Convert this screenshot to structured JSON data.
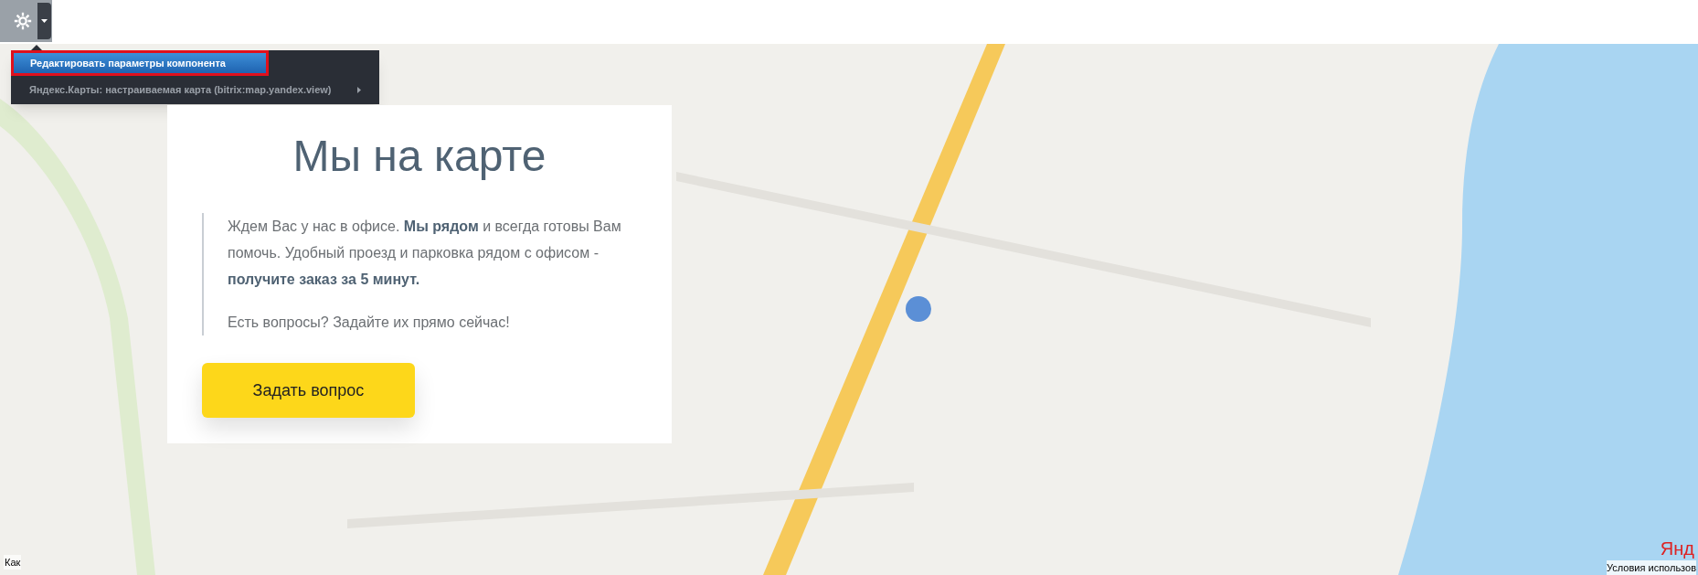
{
  "menu": {
    "items": [
      {
        "label": "Редактировать параметры компонента",
        "selected": true,
        "submenu": false
      },
      {
        "label": "Яндекс.Карты: настраиваемая карта (bitrix:map.yandex.view)",
        "selected": false,
        "submenu": true
      }
    ]
  },
  "card": {
    "title": "Мы на карте",
    "paragraphs": [
      "Ждем Вас у нас в офисе. **Мы рядом** и всегда готовы Вам помочь. Удобный проезд и парковка рядом с офисом - **получите заказ за 5 минут.**",
      "Есть вопросы? Задайте их прямо сейчас!"
    ],
    "button": "Задать вопрос"
  },
  "map": {
    "route_label": "Как",
    "logo": "Янд",
    "terms": "Условия использов"
  }
}
